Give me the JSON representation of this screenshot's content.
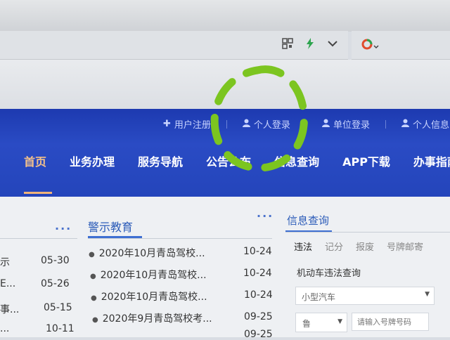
{
  "browser": {
    "icons": [
      "qr-code-icon",
      "lightning-icon",
      "chevron-down-icon",
      "extension-icon"
    ]
  },
  "topbar": {
    "items": [
      {
        "icon": "plus-icon",
        "label": "用户注册"
      },
      {
        "icon": "user-icon",
        "label": "个人登录"
      },
      {
        "icon": "user-icon",
        "label": "单位登录"
      },
      {
        "icon": "user-icon",
        "label": "个人信息申诉"
      }
    ]
  },
  "nav": {
    "items": [
      "首页",
      "业务办理",
      "服务导航",
      "公告公布",
      "信息查询",
      "APP下载",
      "办事指南"
    ],
    "active": "首页"
  },
  "left_column": {
    "more": "···",
    "rows": [
      {
        "title": "示",
        "date": "05-30"
      },
      {
        "title": "E...",
        "date": "05-26"
      },
      {
        "title": "事...",
        "date": "05-15"
      },
      {
        "title": "...",
        "date": "10-11"
      }
    ]
  },
  "warning_column": {
    "title": "警示教育",
    "more": "···",
    "rows": [
      {
        "title": "2020年10月青岛驾校...",
        "date": "10-24"
      },
      {
        "title": "2020年10月青岛驾校...",
        "date": "10-24"
      },
      {
        "title": "2020年10月青岛驾校...",
        "date": "10-24"
      },
      {
        "title": "2020年9月青岛驾校考...",
        "date": "09-25"
      },
      {
        "title": "",
        "date": "09-25"
      }
    ]
  },
  "info_panel": {
    "title": "信息查询",
    "tabs": [
      "违法",
      "记分",
      "报废",
      "号牌邮寄"
    ],
    "active_tab": "违法",
    "query_heading": "机动车违法查询",
    "vehicle_type": "小型汽车",
    "province": "鲁",
    "plate_placeholder": "请输入号牌号码"
  },
  "colors": {
    "header_blue": "#2445bb",
    "nav_active": "#f5c28a",
    "link_blue": "#2b5bb8",
    "mark_green": "#7cc520"
  }
}
